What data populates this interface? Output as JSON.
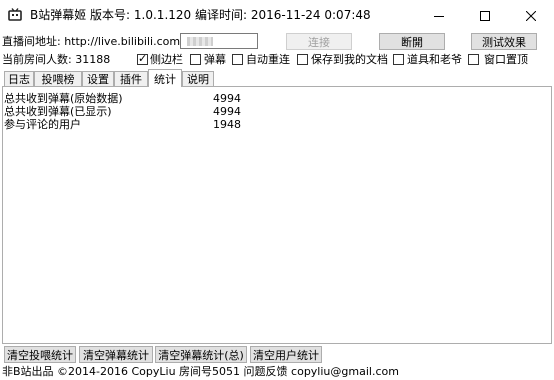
{
  "window": {
    "title": "B站弹幕姬    版本号: 1.0.1.120    编译时间: 2016-11-24 0:07:48"
  },
  "toolbar": {
    "url_label": "直播间地址: http://live.bilibili.com/",
    "url_value": "",
    "connect_label": "连接",
    "disconnect_label": "断開",
    "test_label": "测试效果"
  },
  "options": {
    "viewers_label": "当前房间人数: 31188",
    "sidebar_label": "侧边栏",
    "danmaku_label": "弹幕",
    "auto_reconnect_label": "自动重连",
    "save_docs_label": "保存到我的文档",
    "props_label": "道具和老爷",
    "topmost_label": "窗口置顶"
  },
  "tabs": [
    "日志",
    "投喂榜",
    "设置",
    "插件",
    "统计",
    "说明"
  ],
  "stats": [
    {
      "label": "总共收到弹幕(原始数据)",
      "value": "4994"
    },
    {
      "label": "总共收到弹幕(已显示)",
      "value": "4994"
    },
    {
      "label": "参与评论的用户",
      "value": "1948"
    }
  ],
  "bottom_buttons": {
    "clear_gift": "清空投喂统计",
    "clear_danmaku": "清空弹幕统计",
    "clear_danmaku_total": "清空弹幕统计(总)",
    "clear_users": "清空用户统计"
  },
  "status": {
    "text": "非B站出品 ©2014-2016 CopyLiu 房间号5051 问题反馈 copyliu@gmail.com"
  }
}
